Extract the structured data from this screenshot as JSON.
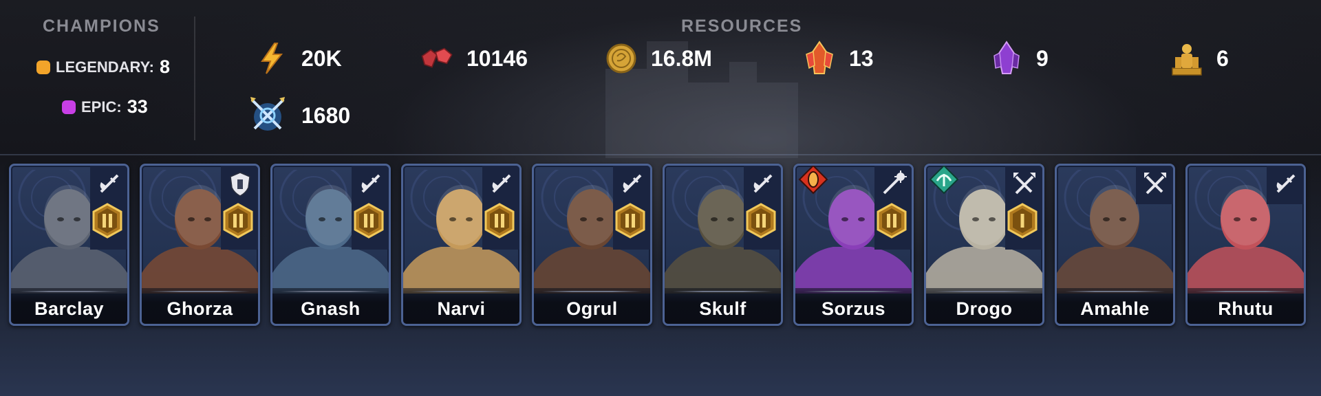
{
  "champions": {
    "title": "CHAMPIONS",
    "legendary": {
      "label": "LEGENDARY:",
      "value": "8",
      "color": "#f2a42a"
    },
    "epic": {
      "label": "EPIC:",
      "value": "33",
      "color": "#c83fe6"
    }
  },
  "resources": {
    "title": "RESOURCES",
    "items": [
      {
        "icon": "energy-lightning-icon",
        "value": "20K"
      },
      {
        "icon": "rubies-gem-icon",
        "value": "10146"
      },
      {
        "icon": "silver-coin-icon",
        "value": "16.8M"
      },
      {
        "icon": "sacred-shard-icon",
        "value": "13"
      },
      {
        "icon": "void-shard-icon",
        "value": "9"
      },
      {
        "icon": "gold-statue-icon",
        "value": "6"
      },
      {
        "icon": "arena-token-icon",
        "value": "1680"
      }
    ]
  },
  "cards": [
    {
      "name": "Barclay",
      "role": "attack-icon",
      "rank": "II",
      "affinity": null
    },
    {
      "name": "Ghorza",
      "role": "defense-icon",
      "rank": "II",
      "affinity": null
    },
    {
      "name": "Gnash",
      "role": "attack-icon",
      "rank": "II",
      "affinity": null
    },
    {
      "name": "Narvi",
      "role": "attack-icon",
      "rank": "II",
      "affinity": null
    },
    {
      "name": "Ogrul",
      "role": "attack-icon",
      "rank": "II",
      "affinity": null
    },
    {
      "name": "Skulf",
      "role": "attack-icon",
      "rank": "II",
      "affinity": null
    },
    {
      "name": "Sorzus",
      "role": "support-icon",
      "rank": "II",
      "affinity": "force-affinity-icon"
    },
    {
      "name": "Drogo",
      "role": "hp-icon",
      "rank": "I",
      "affinity": "spirit-affinity-icon"
    },
    {
      "name": "Amahle",
      "role": "hp-icon",
      "rank": "",
      "affinity": null
    },
    {
      "name": "Rhutu",
      "role": "attack-icon",
      "rank": "",
      "affinity": null
    }
  ],
  "colors": {
    "card_border": "#4c6293",
    "rank_gold": "#e2b23a",
    "force": "#d8321e",
    "spirit": "#2aa58a"
  }
}
